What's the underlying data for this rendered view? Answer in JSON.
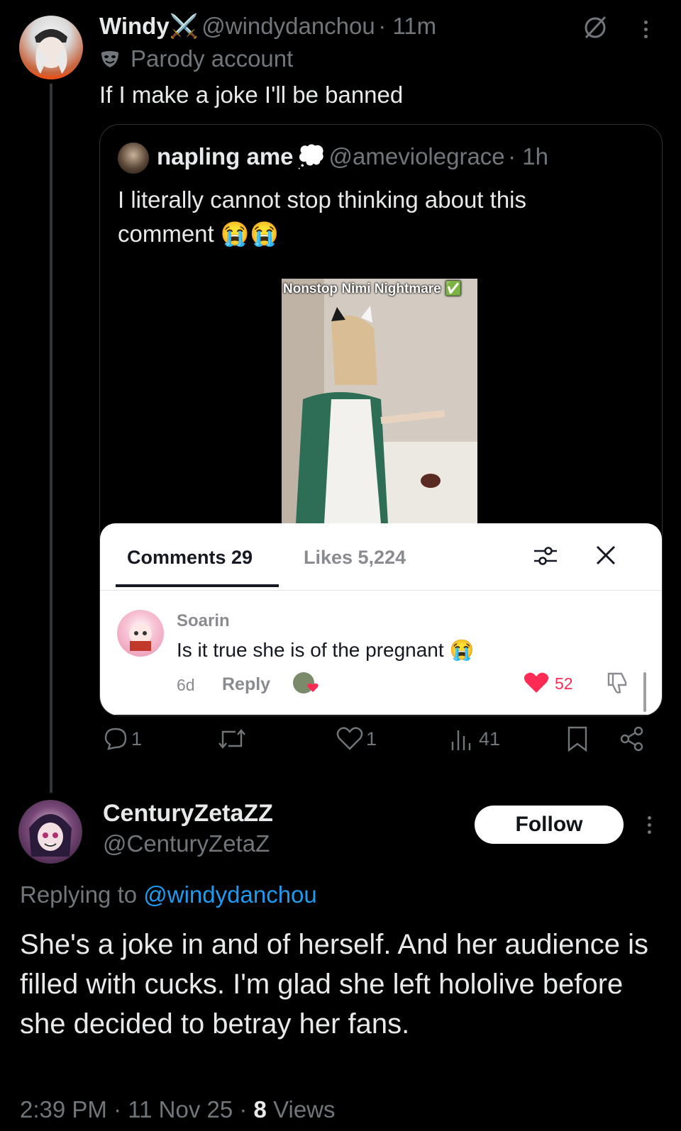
{
  "tweet": {
    "author_name": "Windy",
    "author_emoji": "⚔️",
    "author_handle": "@windydanchou",
    "time": "· 11m",
    "badge_label": "Parody account",
    "text": "If I make a joke I'll be banned",
    "stats": {
      "replies": "1",
      "likes": "1",
      "views": "41"
    }
  },
  "quoted": {
    "author_name": "napling ame",
    "author_emoji": "💭",
    "author_handle": "@ameviolegrace",
    "time": "· 1h",
    "text_line1": "I literally cannot stop thinking about this",
    "text_line2": "comment 😭😭",
    "video_title": "Nonstop Nimi Nightmare ✅",
    "comments_panel": {
      "tab_comments": "Comments 29",
      "tab_likes": "Likes 5,224",
      "comment": {
        "user": "Soarin",
        "text": "Is it true she is of the pregnant 😭",
        "age": "6d",
        "reply_label": "Reply",
        "likes": "52"
      }
    }
  },
  "reply": {
    "author_name": "CenturyZetaZZ",
    "author_handle": "@CenturyZetaZ",
    "follow_label": "Follow",
    "replying_prefix": "Replying to ",
    "replying_handle": "@windydanchou",
    "text": "She's a joke in and of herself. And her audience is filled with cucks. I'm glad she left hololive before she decided to betray her fans.",
    "time": "2:39 PM · 11 Nov 25 · ",
    "views_count": "8",
    "views_label": " Views"
  },
  "colors": {
    "link": "#1d9bf0",
    "muted": "#71767b",
    "tiktok_red": "#fe2c55"
  }
}
